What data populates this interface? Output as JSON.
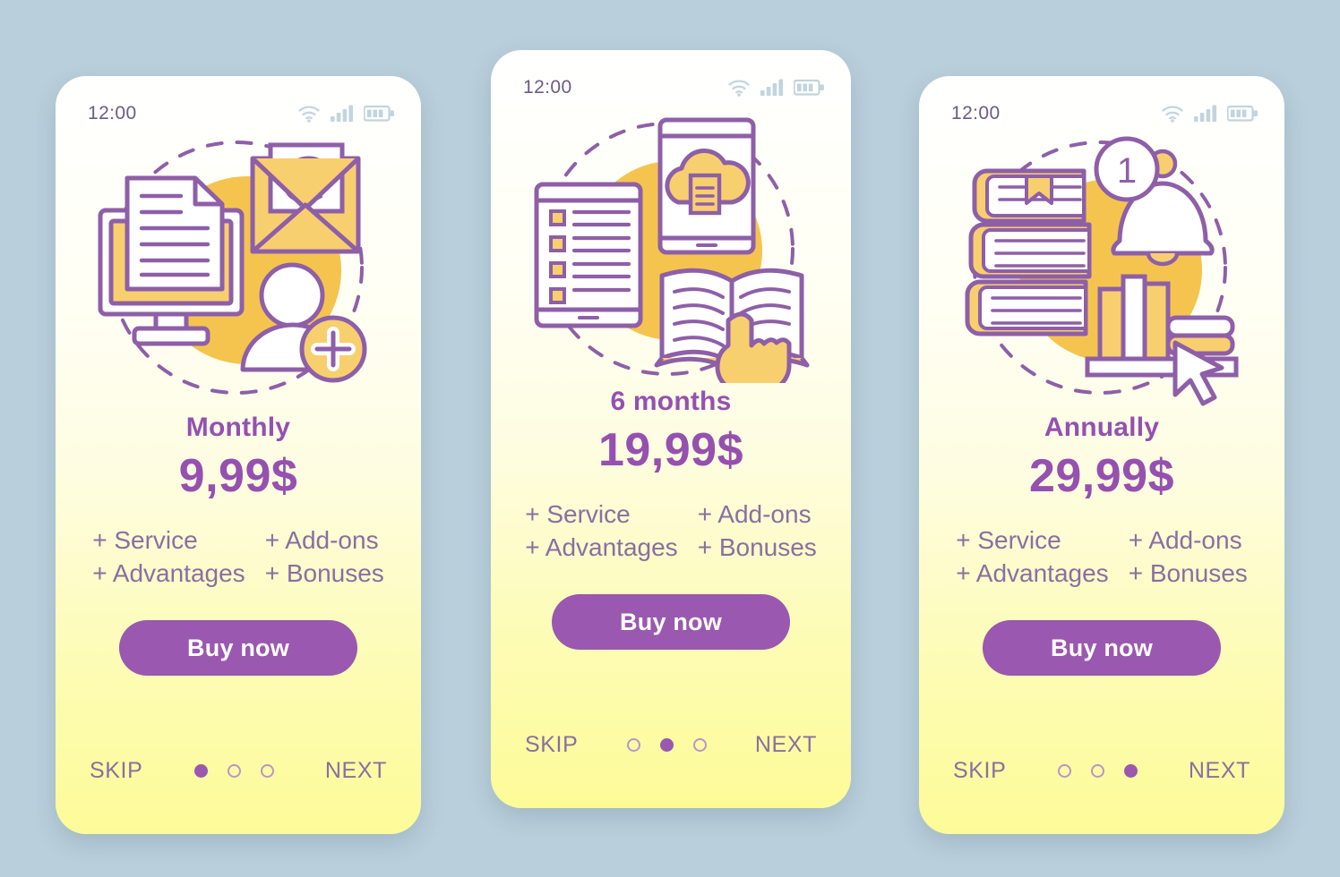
{
  "theme": {
    "page_background": "#b9cfdb",
    "accent_purple": "#9a58b0",
    "title_purple": "#9550b0",
    "muted_purple": "#8a6fa3",
    "accent_yellow": "#f5c44f",
    "status_icon_color": "#c2d4de"
  },
  "screens": [
    {
      "status": {
        "time": "12:00",
        "wifi_icon": "wifi-icon",
        "signal_icon": "signal-bars-icon",
        "battery_icon": "battery-icon"
      },
      "illustration": {
        "name": "monitor-document-email-adduser-illustration",
        "elements": [
          "monitor-icon",
          "document-icon",
          "envelope-at-icon",
          "user-add-icon",
          "dashed-circle",
          "yellow-blob"
        ]
      },
      "title": "Monthly",
      "price": "9,99$",
      "features": [
        "+ Service",
        "+ Add-ons",
        "+ Advantages",
        "+ Bonuses"
      ],
      "buy_label": "Buy now",
      "skip_label": "SKIP",
      "next_label": "NEXT",
      "dots": [
        true,
        false,
        false
      ]
    },
    {
      "status": {
        "time": "12:00",
        "wifi_icon": "wifi-icon",
        "signal_icon": "signal-bars-icon",
        "battery_icon": "battery-icon"
      },
      "illustration": {
        "name": "tablet-phone-cloud-book-illustration",
        "elements": [
          "tablet-checklist-icon",
          "phone-cloud-document-icon",
          "open-book-hand-icon",
          "dashed-circle",
          "yellow-blob"
        ]
      },
      "title": "6 months",
      "price": "19,99$",
      "features": [
        "+ Service",
        "+ Add-ons",
        "+ Advantages",
        "+ Bonuses"
      ],
      "buy_label": "Buy now",
      "skip_label": "SKIP",
      "next_label": "NEXT",
      "dots": [
        false,
        true,
        false
      ]
    },
    {
      "status": {
        "time": "12:00",
        "wifi_icon": "wifi-icon",
        "signal_icon": "signal-bars-icon",
        "battery_icon": "battery-icon"
      },
      "illustration": {
        "name": "books-bell-notification-cursor-illustration",
        "elements": [
          "book-stack-icon",
          "bookmark-icon",
          "notification-bell-icon",
          "badge-1",
          "shelf-books-icon",
          "cursor-icon",
          "dashed-circle",
          "yellow-blob"
        ],
        "badge_text": "1"
      },
      "title": "Annually",
      "price": "29,99$",
      "features": [
        "+ Service",
        "+ Add-ons",
        "+ Advantages",
        "+ Bonuses"
      ],
      "buy_label": "Buy now",
      "skip_label": "SKIP",
      "next_label": "NEXT",
      "dots": [
        false,
        false,
        true
      ]
    }
  ]
}
